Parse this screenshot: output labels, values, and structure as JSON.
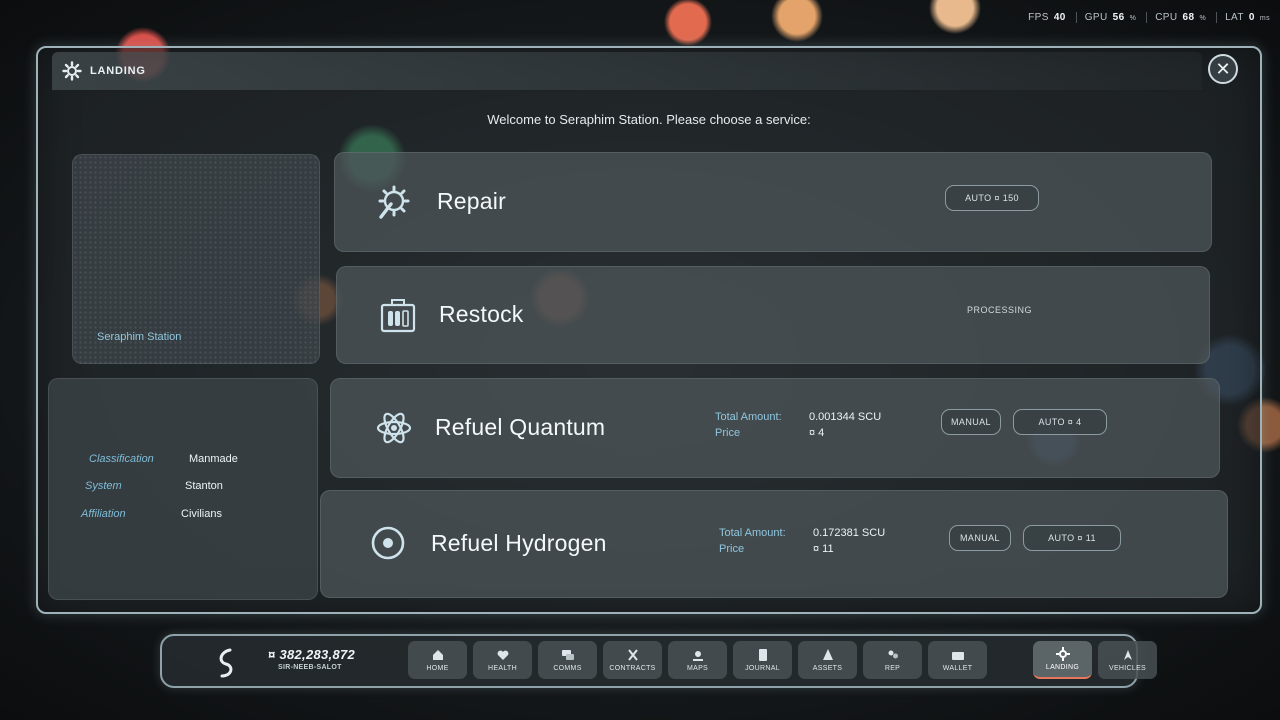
{
  "hud": {
    "fps_label": "FPS",
    "fps_value": "40",
    "gpu_label": "GPU",
    "gpu_value": "56",
    "gpu_unit": "%",
    "cpu_label": "CPU",
    "cpu_value": "68",
    "cpu_unit": "%",
    "lat_label": "LAT",
    "lat_value": "0",
    "lat_unit": "ms"
  },
  "window": {
    "title": "LANDING",
    "close_icon": "close-icon"
  },
  "welcome": "Welcome to Seraphim Station. Please choose a service:",
  "station": {
    "name": "Seraphim Station"
  },
  "info": [
    {
      "key": "Classification",
      "value": "Manmade"
    },
    {
      "key": "System",
      "value": "Stanton"
    },
    {
      "key": "Affiliation",
      "value": "Civilians"
    }
  ],
  "services": {
    "repair": {
      "name": "Repair",
      "icon": "gear-wrench-icon",
      "auto_label": "AUTO ¤ 150"
    },
    "restock": {
      "name": "Restock",
      "icon": "ammo-crate-icon",
      "status": "PROCESSING"
    },
    "quantum": {
      "name": "Refuel Quantum",
      "icon": "atom-icon",
      "total_label": "Total Amount:",
      "total_value": "0.001344 SCU",
      "price_label": "Price",
      "price_value": "¤ 4",
      "manual_label": "MANUAL",
      "auto_label": "AUTO ¤ 4"
    },
    "hydrogen": {
      "name": "Refuel Hydrogen",
      "icon": "hydrogen-icon",
      "total_label": "Total Amount:",
      "total_value": "0.172381 SCU",
      "price_label": "Price",
      "price_value": "¤ 11",
      "manual_label": "MANUAL",
      "auto_label": "AUTO ¤ 11"
    }
  },
  "navbar": {
    "credits": "¤ 382,283,872",
    "handle": "SIR-NEEB-SALOT",
    "items": [
      {
        "label": "HOME",
        "icon": "home-icon"
      },
      {
        "label": "HEALTH",
        "icon": "heart-icon"
      },
      {
        "label": "COMMS",
        "icon": "chat-icon"
      },
      {
        "label": "CONTRACTS",
        "icon": "contracts-icon"
      },
      {
        "label": "MAPS",
        "icon": "map-icon"
      },
      {
        "label": "JOURNAL",
        "icon": "journal-icon"
      },
      {
        "label": "ASSETS",
        "icon": "assets-icon"
      },
      {
        "label": "REP",
        "icon": "rep-icon"
      },
      {
        "label": "WALLET",
        "icon": "wallet-icon"
      },
      {
        "label": "LANDING",
        "icon": "landing-icon"
      },
      {
        "label": "VEHICLES",
        "icon": "vehicles-icon"
      }
    ],
    "active": "LANDING"
  },
  "colors": {
    "accent": "#8fc7df",
    "active_underline": "#e8785a",
    "panel_border": "#9fb2ba"
  }
}
